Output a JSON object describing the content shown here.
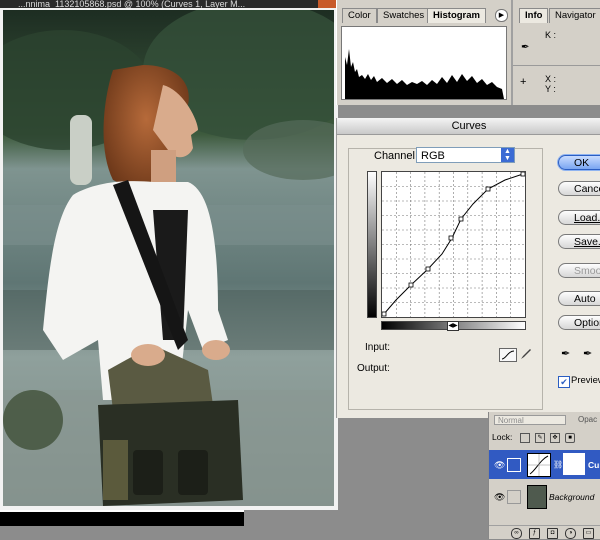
{
  "document": {
    "title": "...nnima_1132105868.psd @ 100% (Curves 1, Layer M..."
  },
  "histogram_panel": {
    "tabs": [
      {
        "label": "Color"
      },
      {
        "label": "Swatches"
      },
      {
        "label": "Histogram"
      }
    ],
    "menu_icon": "play-arrow-icon"
  },
  "info_panel": {
    "tabs": [
      {
        "label": "Info"
      },
      {
        "label": "Navigator"
      }
    ],
    "k_label": "K :",
    "x_label": "X :",
    "y_label": "Y :",
    "eyedropper_icon": "eyedropper-icon",
    "crosshair_icon": "crosshair-icon"
  },
  "curves_dialog": {
    "title": "Curves",
    "channel_label": "Channel:",
    "channel_value": "RGB",
    "input_label": "Input:",
    "output_label": "Output:",
    "buttons": {
      "ok": "OK",
      "cancel": "Cancel",
      "load": "Load...",
      "save": "Save...",
      "smooth": "Smooth",
      "auto": "Auto",
      "options": "Options..."
    },
    "preview_label": "Preview",
    "preview_checked": true
  },
  "layers_panel": {
    "blend_mode": "Normal",
    "opacity_label": "Opac",
    "lock_label": "Lock:",
    "layers": [
      {
        "name": "Cur",
        "selected": true,
        "visible": true
      },
      {
        "name": "Background",
        "selected": false,
        "visible": true
      }
    ]
  },
  "colors": {
    "selection_blue": "#315ac2",
    "dialog_bg": "#ece9e1",
    "panel_bg": "#d4d0c8"
  }
}
